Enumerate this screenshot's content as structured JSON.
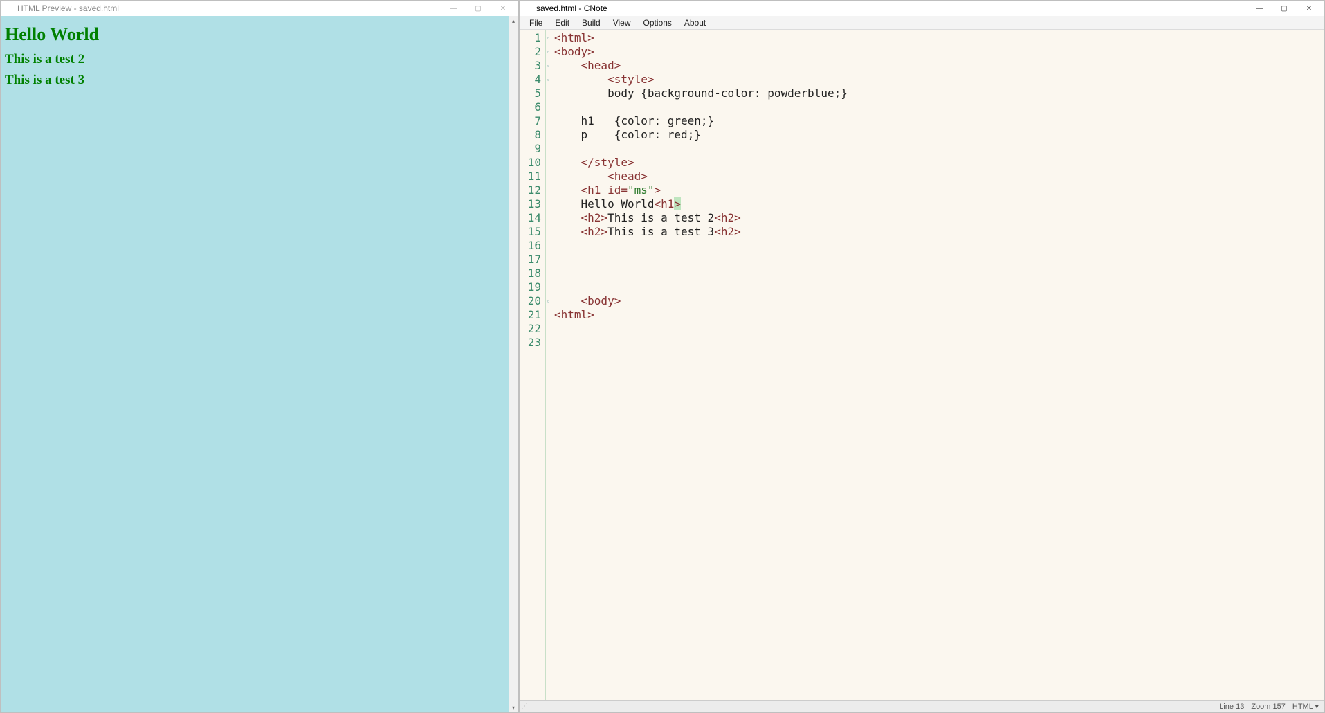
{
  "left_window": {
    "title": "HTML Preview - saved.html",
    "content": {
      "h1": "Hello World",
      "h2a": "This is a test 2",
      "h2b": "This is a test 3"
    }
  },
  "right_window": {
    "title": "saved.html - CNote",
    "menu": {
      "file": "File",
      "edit": "Edit",
      "build": "Build",
      "view": "View",
      "options": "Options",
      "about": "About"
    },
    "status": {
      "line": "Line 13",
      "zoom": "Zoom 157",
      "lang": "HTML ▾"
    },
    "line_numbers": [
      "1",
      "2",
      "3",
      "4",
      "5",
      "6",
      "7",
      "8",
      "9",
      "10",
      "11",
      "12",
      "13",
      "14",
      "15",
      "16",
      "17",
      "18",
      "19",
      "20",
      "21",
      "22",
      "23"
    ],
    "code_lines": [
      {
        "raw": "<html>",
        "indent": 0
      },
      {
        "raw": "<body>",
        "indent": 0
      },
      {
        "raw": "    <head>",
        "indent": 0
      },
      {
        "raw": "        <style>",
        "indent": 0
      },
      {
        "raw": "        body {background-color: powderblue;}",
        "indent": 0,
        "plain": true
      },
      {
        "raw": "",
        "indent": 0,
        "plain": true
      },
      {
        "raw": "    h1   {color: green;}",
        "indent": 0,
        "plain": true
      },
      {
        "raw": "    p    {color: red;}",
        "indent": 0,
        "plain": true
      },
      {
        "raw": "",
        "indent": 0,
        "plain": true
      },
      {
        "raw": "    </style>",
        "indent": 0
      },
      {
        "raw": "        <head>",
        "indent": 0
      },
      {
        "raw": "    <h1 id=\"ms\">",
        "indent": 0,
        "attrline": true
      },
      {
        "raw": "    Hello World<h1>",
        "indent": 0,
        "mixed": true,
        "text_part": "    Hello World",
        "tag_part": "<h1",
        "tag_close": ">",
        "hl": true
      },
      {
        "raw": "    <h2>This is a test 2<h2>",
        "indent": 0,
        "mixed2": true,
        "open": "    <h2>",
        "mid": "This is a test 2",
        "close": "<h2>"
      },
      {
        "raw": "    <h2>This is a test 3<h2>",
        "indent": 0,
        "mixed2": true,
        "open": "    <h2>",
        "mid": "This is a test 3",
        "close": "<h2>"
      },
      {
        "raw": "",
        "indent": 0,
        "plain": true
      },
      {
        "raw": "",
        "indent": 0,
        "plain": true
      },
      {
        "raw": "",
        "indent": 0,
        "plain": true
      },
      {
        "raw": "",
        "indent": 0,
        "plain": true
      },
      {
        "raw": "    <body>",
        "indent": 0
      },
      {
        "raw": "<html>",
        "indent": 0
      },
      {
        "raw": "",
        "indent": 0,
        "plain": true
      },
      {
        "raw": "",
        "indent": 0,
        "plain": true
      }
    ]
  }
}
